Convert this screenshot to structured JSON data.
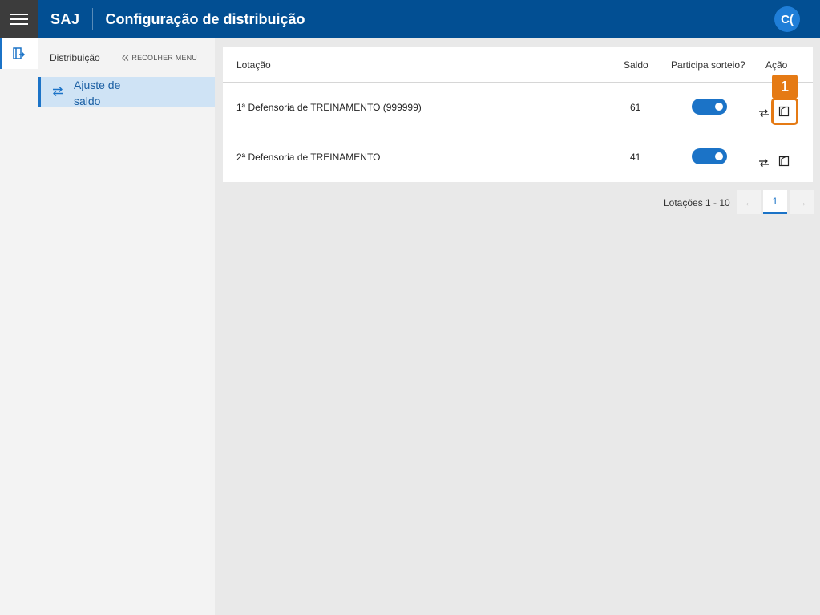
{
  "header": {
    "brand": "SAJ",
    "title": "Configuração de distribuição",
    "avatar_initials": "C("
  },
  "sidemenu": {
    "title": "Distribuição",
    "collapse_label": "RECOLHER MENU",
    "items": [
      {
        "label": "Ajuste de saldo",
        "icon": "swap-arrows-icon"
      }
    ]
  },
  "table": {
    "columns": [
      "Lotação",
      "Saldo",
      "Participa sorteio?",
      "Ação"
    ],
    "rows": [
      {
        "lotacao": "1ª Defensoria de TREINAMENTO (999999)",
        "saldo": "61",
        "participa": true
      },
      {
        "lotacao": "2ª Defensoria de TREINAMENTO",
        "saldo": "41",
        "participa": true
      }
    ]
  },
  "annotation": {
    "badge": "1",
    "color": "#e57a14"
  },
  "pagination": {
    "label": "Lotações 1 - 10",
    "current_page": "1"
  },
  "colors": {
    "header_bg": "#024f93",
    "accent": "#1b73c7",
    "selected_menu_bg": "#cfe3f5"
  }
}
